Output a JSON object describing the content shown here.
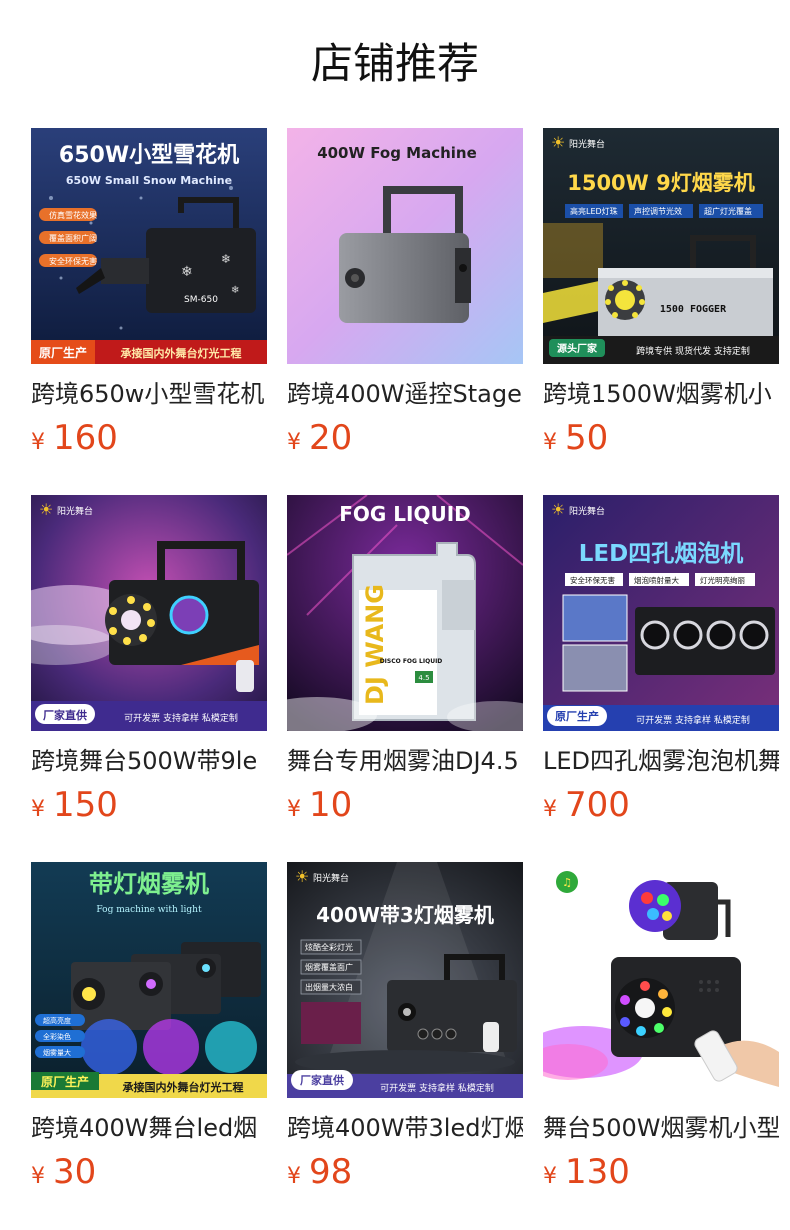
{
  "section_title": "店铺推荐",
  "products": [
    {
      "name": "跨境650w小型雪花机",
      "currency": "¥",
      "price": "160",
      "image": {
        "headline": "650W小型雪花机",
        "subline": "650W Small Snow Machine",
        "tags": [
          "仿真雪花效果",
          "覆盖面积广阔",
          "安全环保无害"
        ],
        "model": "SM-650",
        "badge": "原厂生产",
        "banner": "承接国内外舞台灯光工程"
      }
    },
    {
      "name": "跨境400W遥控Stage",
      "currency": "¥",
      "price": "20",
      "image": {
        "headline": "400W Fog Machine"
      }
    },
    {
      "name": "跨境1500W烟雾机小",
      "currency": "¥",
      "price": "50",
      "image": {
        "brand": "阳光舞台",
        "headline": "1500W 9灯烟雾机",
        "tags": [
          "高亮LED灯珠",
          "声控调节光效",
          "超广灯光覆盖"
        ],
        "model": "1500 FOGGER",
        "badge": "源头厂家",
        "banner": "跨境专供 现货代发 支持定制"
      }
    },
    {
      "name": "跨境舞台500W带9le",
      "currency": "¥",
      "price": "150",
      "image": {
        "brand": "阳光舞台",
        "badge": "厂家直供",
        "banner": "可开发票 支持拿样 私模定制"
      }
    },
    {
      "name": "舞台专用烟雾油DJ4.5",
      "currency": "¥",
      "price": "10",
      "image": {
        "headline": "FOG LIQUID",
        "bottle_brand": "DJ WANG",
        "bottle_label": "DISCO FOG LIQUID",
        "volume": "4.5"
      }
    },
    {
      "name": "LED四孔烟雾泡泡机舞",
      "currency": "¥",
      "price": "700",
      "image": {
        "brand": "阳光舞台",
        "headline": "LED四孔烟泡机",
        "tags": [
          "安全环保无害",
          "烟泡喷射量大",
          "灯光明亮绚丽"
        ],
        "badge": "原厂生产",
        "banner": "可开发票 支持拿样 私模定制"
      }
    },
    {
      "name": "跨境400W舞台led烟",
      "currency": "¥",
      "price": "30",
      "image": {
        "headline": "带灯烟雾机",
        "subline": "Fog machine with light",
        "tags": [
          "超高亮度",
          "全彩染色",
          "烟雾量大"
        ],
        "badge": "原厂生产",
        "banner": "承接国内外舞台灯光工程"
      }
    },
    {
      "name": "跨境400W带3led灯烟",
      "currency": "¥",
      "price": "98",
      "image": {
        "brand": "阳光舞台",
        "headline": "400W带3灯烟雾机",
        "tags": [
          "炫酷全彩灯光",
          "烟雾覆盖面广",
          "出烟量大浓白"
        ],
        "badge": "厂家直供",
        "banner": "可开发票 支持拿样 私模定制"
      }
    },
    {
      "name": "舞台500W烟雾机小型",
      "currency": "¥",
      "price": "130",
      "image": {}
    }
  ]
}
